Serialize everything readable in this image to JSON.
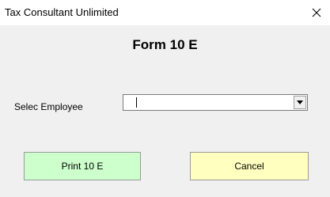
{
  "window": {
    "title": "Tax Consultant Unlimited"
  },
  "form": {
    "heading": "Form 10 E",
    "employee_label": "Selec Employee",
    "employee_value": ""
  },
  "buttons": {
    "print_label": "Print 10 E",
    "cancel_label": "Cancel"
  },
  "colors": {
    "print_button_bg": "#ccffcc",
    "cancel_button_bg": "#ffffc0",
    "dialog_bg": "#f0f0f0"
  },
  "icons": {
    "close": "close-icon",
    "dropdown": "chevron-down-icon"
  }
}
